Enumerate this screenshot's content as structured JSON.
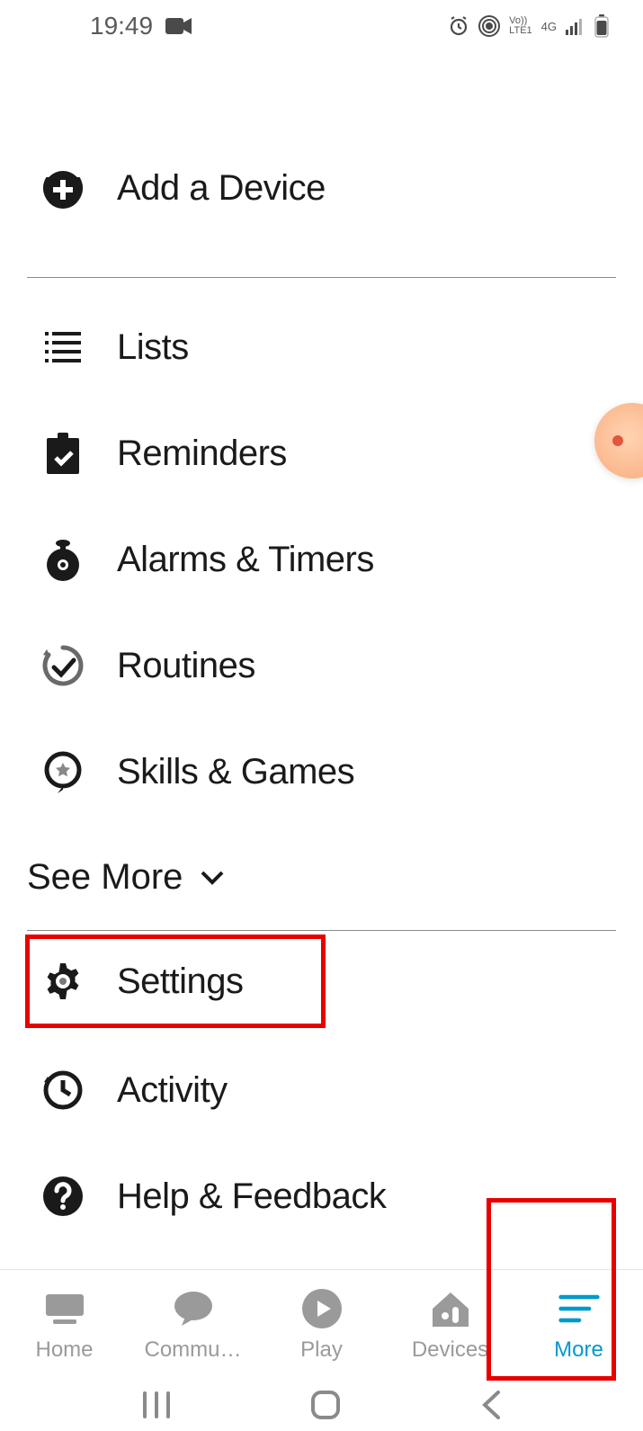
{
  "status": {
    "time": "19:49",
    "lte": "Vo))\nLTE1",
    "net": "4G"
  },
  "menu": {
    "addDevice": "Add a Device",
    "lists": "Lists",
    "reminders": "Reminders",
    "alarms": "Alarms & Timers",
    "routines": "Routines",
    "skills": "Skills & Games",
    "seeMore": "See More",
    "settings": "Settings",
    "activity": "Activity",
    "help": "Help & Feedback"
  },
  "nav": {
    "home": "Home",
    "communicate": "Commu…",
    "play": "Play",
    "devices": "Devices",
    "more": "More"
  }
}
